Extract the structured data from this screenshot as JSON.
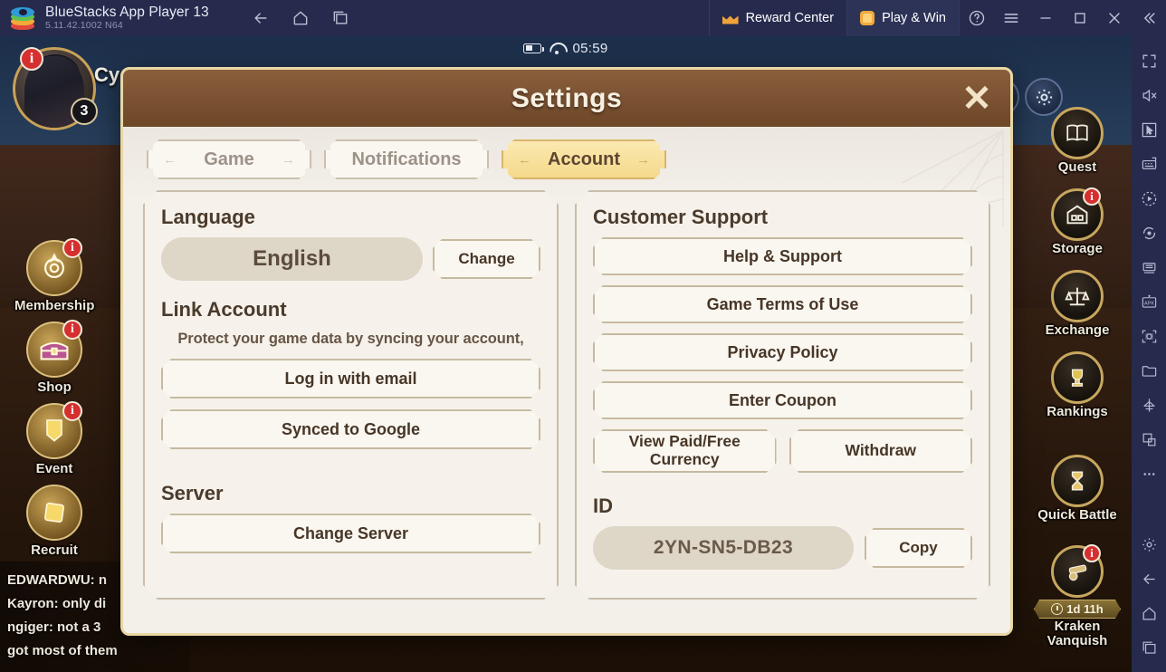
{
  "titlebar": {
    "app_name": "BlueStacks App Player 13",
    "version": "5.11.42.1002  N64",
    "logo_icon": "bluestacks-logo",
    "nav": [
      {
        "name": "back",
        "icon": "arrow-left-icon"
      },
      {
        "name": "home",
        "icon": "home-icon"
      },
      {
        "name": "multi-instance",
        "icon": "windows-icon"
      }
    ],
    "reward_center": {
      "label": "Reward Center",
      "icon": "crown-icon"
    },
    "play_and_win": {
      "label": "Play & Win",
      "icon": "gem-icon"
    },
    "window_buttons": [
      {
        "name": "help",
        "icon": "question-circle-icon"
      },
      {
        "name": "menu",
        "icon": "hamburger-icon"
      },
      {
        "name": "minimize",
        "icon": "minimize-icon"
      },
      {
        "name": "maximize",
        "icon": "maximize-icon"
      },
      {
        "name": "close",
        "icon": "close-icon"
      },
      {
        "name": "collapse-sidebar",
        "icon": "double-chevron-left-icon"
      }
    ]
  },
  "android_status": {
    "battery_icon": "battery-icon",
    "wifi_icon": "wifi-icon",
    "clock": "05:59"
  },
  "game": {
    "player": {
      "name": "Cy",
      "notification_badge": "i",
      "level_badge": "3"
    },
    "left_nav": [
      {
        "label": "Membership",
        "icon": "medal-icon",
        "badge": "i"
      },
      {
        "label": "Shop",
        "icon": "treasure-chest-icon",
        "badge": "i"
      },
      {
        "label": "Event",
        "icon": "event-banner-icon",
        "badge": "i"
      },
      {
        "label": "Recruit",
        "icon": "recruit-scroll-icon",
        "badge": ""
      }
    ],
    "top_icons": [
      {
        "name": "compass-icon"
      },
      {
        "name": "gear-icon"
      }
    ],
    "right_nav": [
      {
        "label": "Quest",
        "icon": "book-icon",
        "badge": ""
      },
      {
        "label": "Storage",
        "icon": "warehouse-icon",
        "badge": "i"
      },
      {
        "label": "Exchange",
        "icon": "scales-icon",
        "badge": ""
      },
      {
        "label": "Rankings",
        "icon": "trophy-icon",
        "badge": ""
      },
      {
        "label": "Quick Battle",
        "icon": "hourglass-icon",
        "badge": ""
      },
      {
        "label": "Kraken Vanquish",
        "icon": "cannon-icon",
        "badge": "i",
        "timer": "1d 11h",
        "timer_icon": "clock-icon"
      }
    ],
    "chat": [
      {
        "text": "EDWARDWU: n"
      },
      {
        "text": "Kayron: only di"
      },
      {
        "text": "ngiger: not a 3 "
      },
      {
        "text": "got most of them"
      }
    ]
  },
  "settings": {
    "title": "Settings",
    "close_icon": "close-icon",
    "tabs": [
      {
        "label": "Game",
        "active": false
      },
      {
        "label": "Notifications",
        "active": false
      },
      {
        "label": "Account",
        "active": true
      }
    ],
    "left_panel": {
      "language": {
        "title": "Language",
        "value": "English",
        "change_button": "Change"
      },
      "link_account": {
        "title": "Link Account",
        "note": "Protect your game data by syncing your account,",
        "buttons": [
          "Log in with email",
          "Synced to Google"
        ]
      },
      "server": {
        "title": "Server",
        "button": "Change Server"
      }
    },
    "right_panel": {
      "customer_support": {
        "title": "Customer Support",
        "buttons": [
          "Help & Support",
          "Game Terms of Use",
          "Privacy Policy",
          "Enter Coupon"
        ],
        "split_buttons": [
          "View Paid/Free Currency",
          "Withdraw"
        ]
      },
      "id": {
        "title": "ID",
        "value": "2YN-SN5-DB23",
        "copy_button": "Copy"
      }
    }
  },
  "bluestacks_sidebar": [
    {
      "name": "fullscreen-icon"
    },
    {
      "name": "mute-icon"
    },
    {
      "name": "cursor-icon"
    },
    {
      "name": "keyboard-controls-icon"
    },
    {
      "name": "macro-record-icon"
    },
    {
      "name": "rotate-icon"
    },
    {
      "name": "multi-instance-sync-icon"
    },
    {
      "name": "install-apk-icon"
    },
    {
      "name": "screenshot-icon"
    },
    {
      "name": "media-folder-icon"
    },
    {
      "name": "eco-mode-icon"
    },
    {
      "name": "copy-icon"
    },
    {
      "name": "more-icon"
    },
    {
      "name": "settings-gear-icon"
    },
    {
      "name": "back-arrow-icon"
    },
    {
      "name": "home-icon"
    },
    {
      "name": "recents-icon"
    }
  ],
  "colors": {
    "titlebar_bg": "#262b4e",
    "accent_orange": "#f0a33a",
    "modal_header": "#7a5132",
    "modal_border": "#e8d7a4",
    "tab_active": "#f5d98b",
    "badge_red": "#d52f2f"
  }
}
